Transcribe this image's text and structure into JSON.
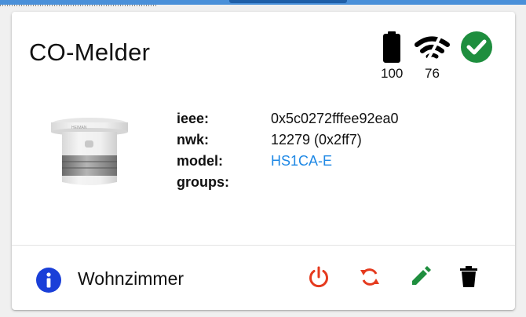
{
  "device": {
    "name": "CO-Melder",
    "battery": "100",
    "link_quality": "76",
    "room": "Wohnzimmer"
  },
  "details": [
    {
      "key": "ieee:",
      "value": "0x5c0272fffee92ea0"
    },
    {
      "key": "nwk:",
      "value": "12279 (0x2ff7)"
    },
    {
      "key": "model:",
      "value": "HS1CA-E"
    },
    {
      "key": "groups:",
      "value": ""
    }
  ],
  "icons": {
    "battery": "battery-full-icon",
    "signal": "wifi-signal-icon",
    "status": "check-circle-icon",
    "info": "info-icon",
    "power": "power-icon",
    "refresh": "sync-icon",
    "edit": "pencil-icon",
    "delete": "trash-icon"
  },
  "colors": {
    "ok_green": "#1e8e3e",
    "info_blue": "#1a3fd8",
    "action_red": "#e53a1e",
    "edit_green": "#1e8e3e",
    "link_blue": "#1e88e5"
  }
}
